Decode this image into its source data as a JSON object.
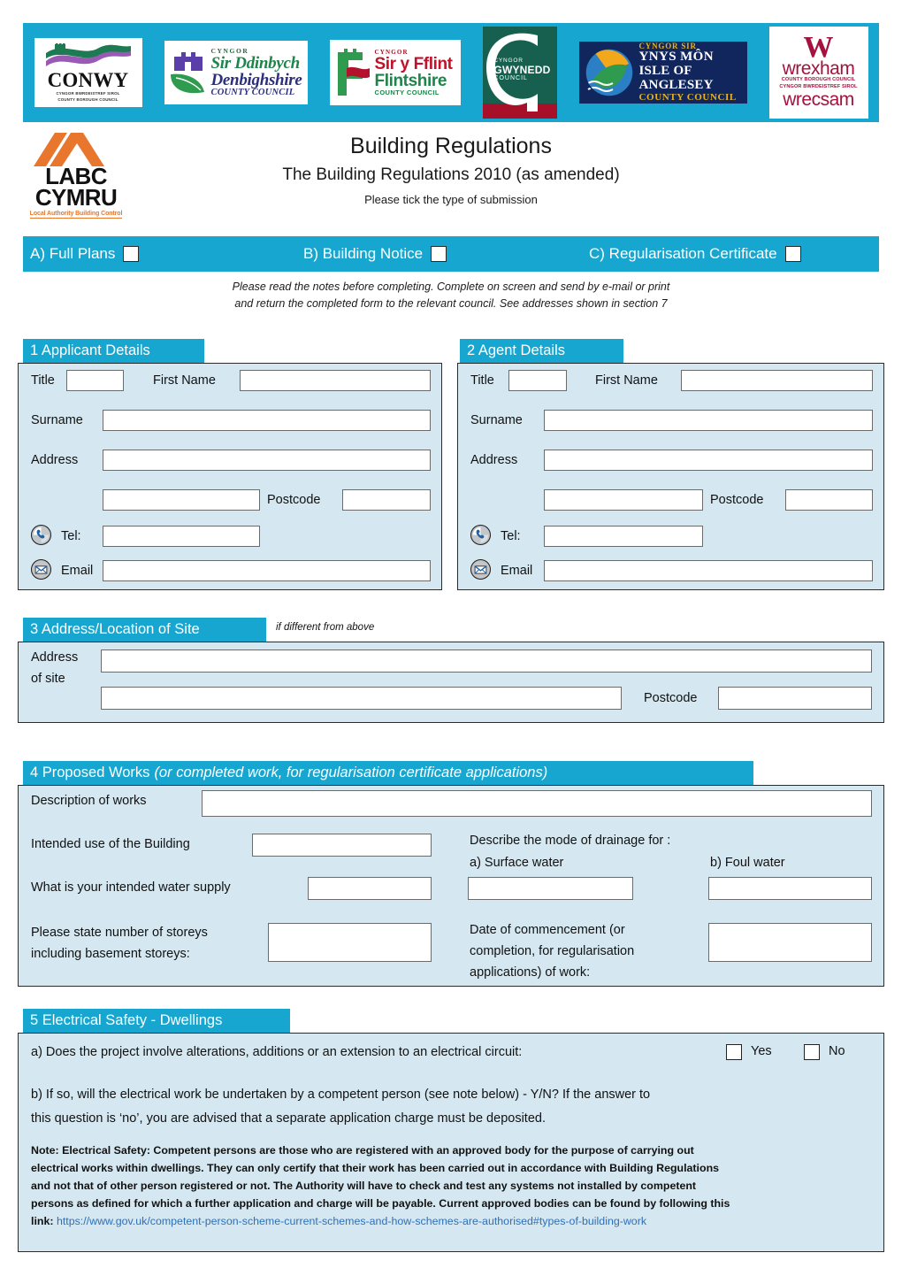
{
  "logos": [
    {
      "name": "Conwy County Borough Council",
      "title": "CONWY",
      "sub1": "CYNGOR BWRDEISTREF SIROL",
      "sub2": "COUNTY BOROUGH COUNCIL"
    },
    {
      "name": "Denbighshire County Council",
      "cyngor": "CYNGOR",
      "line1": "Sir Ddinbych",
      "line2": "Denbighshire",
      "line3": "COUNTY COUNCIL"
    },
    {
      "name": "Flintshire County Council",
      "cyngor": "CYNGOR",
      "line1": "Sir y Fflint",
      "line2": "Flintshire",
      "line3": "COUNTY COUNCIL"
    },
    {
      "name": "Gwynedd Council",
      "line1": "CYNGOR",
      "line2": "GWYNEDD",
      "line3": "COUNCIL"
    },
    {
      "name": "Isle of Anglesey County Council",
      "line1": "CYNGOR SIR",
      "line2": "YNYS MÔN",
      "line3": "ISLE OF ANGLESEY",
      "line4": "COUNTY COUNCIL"
    },
    {
      "name": "Wrexham County Borough Council",
      "w": "W",
      "line1": "wrexham",
      "sub1": "COUNTY BOROUGH COUNCIL",
      "sub2": "CYNGOR BWRDEISTREF SIROL",
      "line2": "wrecsam"
    }
  ],
  "labc": {
    "line1": "LABC",
    "line2": "CYMRU",
    "tagline": "Local Authority Building Control"
  },
  "header": {
    "title": "Building Regulations",
    "subtitle": "The Building Regulations 2010 (as amended)",
    "instruction": "Please tick the type of submission"
  },
  "submission": {
    "options": [
      {
        "label": "A) Full Plans",
        "checked": false
      },
      {
        "label": "B) Building Notice",
        "checked": false
      },
      {
        "label": "C) Regularisation Certificate",
        "checked": false
      }
    ]
  },
  "notice": {
    "line1": "Please read the notes before completing. Complete on screen and send by e-mail or print",
    "line2": "and return the completed form to the relevant council. See addresses shown in section 7"
  },
  "section1": {
    "heading": "1 Applicant Details",
    "labels": {
      "title": "Title",
      "first_name": "First Name",
      "surname": "Surname",
      "address": "Address",
      "postcode": "Postcode",
      "tel": "Tel:",
      "email": "Email"
    },
    "values": {
      "title": "",
      "first_name": "",
      "surname": "",
      "address": "",
      "address2": "",
      "postcode": "",
      "tel": "",
      "email": ""
    }
  },
  "section2": {
    "heading": "2 Agent Details",
    "labels": {
      "title": "Title",
      "first_name": "First Name",
      "surname": "Surname",
      "address": "Address",
      "postcode": "Postcode",
      "tel": "Tel:",
      "email": "Email"
    },
    "values": {
      "title": "",
      "first_name": "",
      "surname": "",
      "address": "",
      "address2": "",
      "postcode": "",
      "tel": "",
      "email": ""
    }
  },
  "section3": {
    "heading": "3 Address/Location of Site",
    "hint": "if different from above",
    "labels": {
      "address_line1": "Address",
      "address_line2": "of site",
      "postcode": "Postcode"
    },
    "values": {
      "address": "",
      "address2": "",
      "postcode": ""
    }
  },
  "section4": {
    "heading": "4 Proposed Works",
    "heading_em": "(or completed work, for regularisation certificate applications)",
    "labels": {
      "description": "Description of works",
      "intended_use": "Intended use of the Building",
      "drainage": "Describe the mode of drainage for :",
      "surface_water": "a) Surface water",
      "foul_water": "b) Foul water",
      "water_supply": "What is your intended water supply",
      "storeys_l1": "Please state number of storeys",
      "storeys_l2": "including basement storeys:",
      "date_l1": "Date of commencement (or",
      "date_l2": "completion, for regularisation",
      "date_l3": "applications) of work:"
    },
    "values": {
      "description": "",
      "intended_use": "",
      "surface_water": "",
      "foul_water": "",
      "water_supply": "",
      "storeys": "",
      "date": ""
    }
  },
  "section5": {
    "heading": "5 Electrical Safety - Dwellings",
    "question_a": "a)   Does the project involve alterations, additions or an extension to an electrical circuit:",
    "yes_label": "Yes",
    "no_label": "No",
    "answer_a": "",
    "question_b_l1": "b)   If so, will the electrical work be undertaken by a competent person (see note below) - Y/N? If the answer to",
    "question_b_l2": "this question is ‘no’, you are advised that a separate application charge must be deposited.",
    "note_lines": [
      "Note: Electrical Safety: Competent persons are those who are registered with an approved body for the purpose of carrying out",
      "electrical works within dwellings. They can only certify that their work has been carried out in accordance with Building Regulations",
      "and not that of other person registered or not. The Authority will have to check and test any systems not installed by competent",
      "persons as defined for which a further application and charge will be payable. Current approved bodies can be found by following this"
    ],
    "note_link_label": "link:",
    "note_link": "https://www.gov.uk/competent-person-scheme-current-schemes-and-how-schemes-are-authorised#types-of-building-work"
  },
  "colors": {
    "accent_teal": "#16A6D0",
    "panel_fill": "#D5E8F1",
    "field_border": "#6b6b6b",
    "link": "#2E6FB7"
  }
}
